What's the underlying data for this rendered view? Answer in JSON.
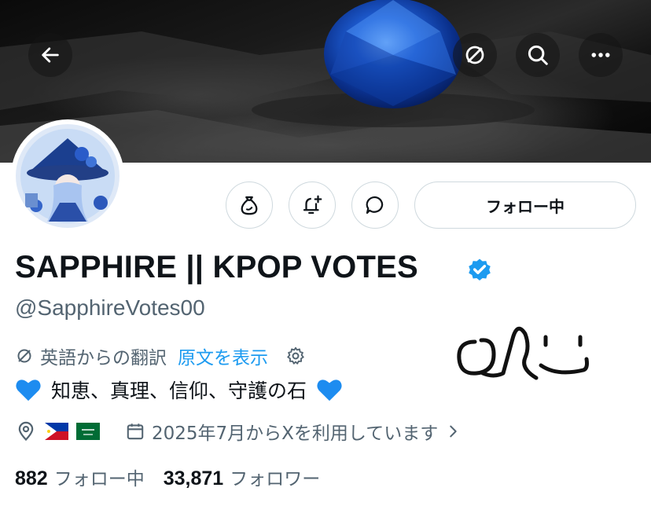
{
  "profile": {
    "display_name": "SAPPHIRE || KPOP VOTES",
    "handle": "@SapphireVotes00",
    "verified": true,
    "bio": "知恵、真理、信仰、守護の石",
    "bio_emoji": "blue-heart-icon",
    "translate_label": "英語からの翻訳",
    "show_original_label": "原文を表示",
    "location_flags": [
      "🇵🇭",
      "🇸🇦"
    ],
    "joined": "2025年7月からXを利用しています"
  },
  "actions": {
    "follow_label": "フォロー中"
  },
  "stats": {
    "following_count": "882",
    "following_label": "フォロー中",
    "followers_count": "33,871",
    "followers_label": "フォロワー"
  },
  "colors": {
    "accent": "#1d9bf0",
    "text": "#0f1419",
    "secondary": "#536471",
    "border": "#cfd9de",
    "heart": "#1d8cf0"
  },
  "icons": [
    "back-arrow-icon",
    "grok-icon",
    "search-icon",
    "more-icon",
    "moneybag-icon",
    "bell-plus-icon",
    "chat-bubble-icon",
    "verified-badge-icon",
    "translate-icon",
    "gear-icon",
    "location-pin-icon",
    "calendar-icon",
    "chevron-right-icon"
  ]
}
